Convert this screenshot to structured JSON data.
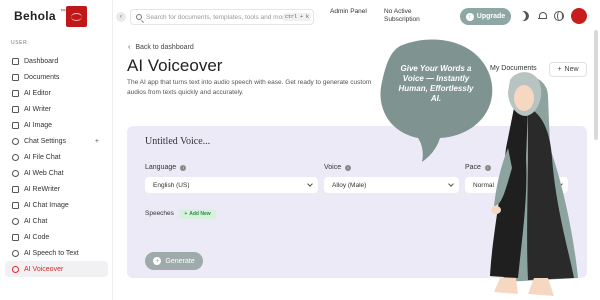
{
  "brand": {
    "name": "Behola",
    "mark": "™"
  },
  "sidebar": {
    "section_label": "USER",
    "items": [
      {
        "label": "Dashboard",
        "icon": "grid-icon"
      },
      {
        "label": "Documents",
        "icon": "document-icon"
      },
      {
        "label": "AI Editor",
        "icon": "editor-icon"
      },
      {
        "label": "AI Writer",
        "icon": "writer-icon"
      },
      {
        "label": "AI Image",
        "icon": "image-icon"
      },
      {
        "label": "Chat Settings",
        "icon": "chat-settings-icon",
        "expand": "+"
      },
      {
        "label": "AI File Chat",
        "icon": "file-chat-icon"
      },
      {
        "label": "AI Web Chat",
        "icon": "web-chat-icon"
      },
      {
        "label": "AI ReWriter",
        "icon": "rewriter-icon"
      },
      {
        "label": "AI Chat Image",
        "icon": "chat-image-icon"
      },
      {
        "label": "AI Chat",
        "icon": "chat-icon"
      },
      {
        "label": "AI Code",
        "icon": "code-icon"
      },
      {
        "label": "AI Speech to Text",
        "icon": "microphone-icon"
      },
      {
        "label": "AI Voiceover",
        "icon": "voiceover-icon",
        "active": true
      }
    ]
  },
  "topbar": {
    "search_placeholder": "Search for documents, templates, tools and more...",
    "search_shortcut": "ctrl + k",
    "admin_panel": "Admin Panel",
    "subscription": "No Active Subscription",
    "upgrade_label": "Upgrade",
    "upgrade_icon": "↑",
    "collapse_icon": "‹"
  },
  "page": {
    "back_arrow": "‹",
    "back_label": "Back to dashboard",
    "title": "AI Voiceover",
    "subtitle": "The AI app that turns text into audio speech with ease. Get ready to generate custom audios from texts quickly and accurately.",
    "my_documents": "My Documents",
    "new_label": "New",
    "new_icon": "+"
  },
  "form": {
    "doc_title": "Untitled Voice...",
    "language_label": "Language",
    "language_value": "English (US)",
    "voice_label": "Voice",
    "voice_value": "Alloy (Male)",
    "pace_label": "Pace",
    "pace_value": "Normal",
    "info_glyph": "i",
    "speeches_label": "Speeches",
    "add_new_label": "Add New",
    "add_new_icon": "+",
    "generate_label": "Generate",
    "generate_icon": "+"
  },
  "promo": {
    "text": "Give Your Words a Voice — Instantly Human, Effortlessly AI."
  },
  "colors": {
    "accent_red": "#d42a2a",
    "upgrade_bg": "#8fa7a4",
    "panel_bg": "#eceaf7",
    "bubble": "#7f9391"
  }
}
